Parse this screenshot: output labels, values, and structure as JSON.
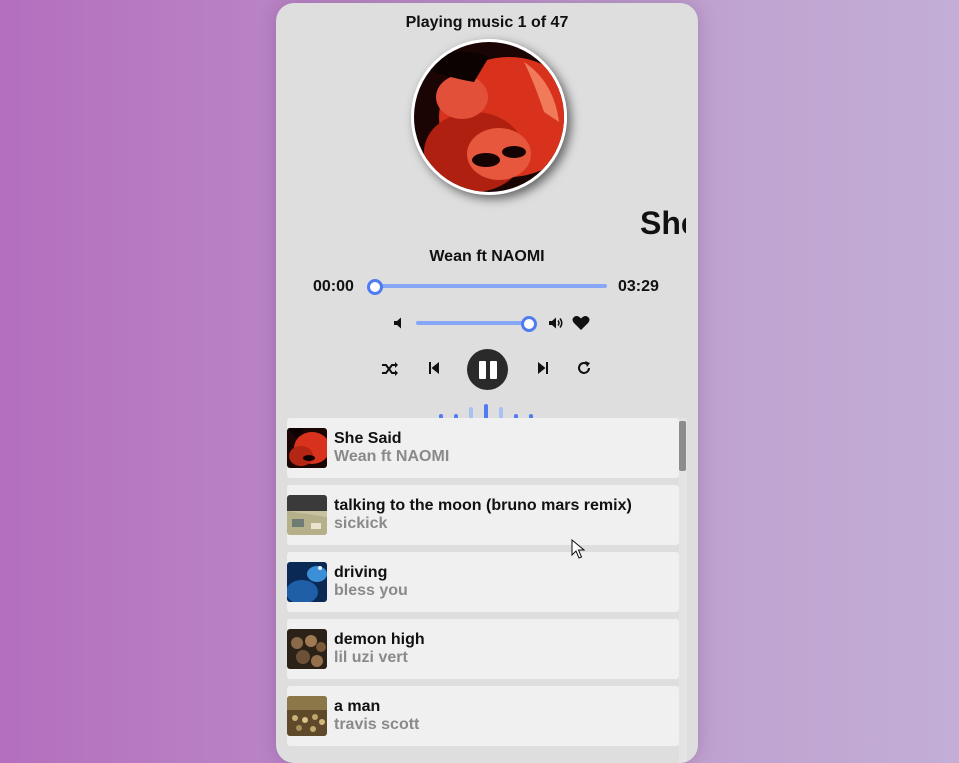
{
  "status_text": "Playing music 1 of 47",
  "now_playing": {
    "title": "She Said",
    "title_visible": "She",
    "artist": "Wean ft NAOMI",
    "current_time": "00:00",
    "total_time": "03:29",
    "progress_fraction": 0.0
  },
  "volume": {
    "level_fraction": 1.0
  },
  "colors": {
    "accent": "#4f7cf0",
    "track": "#86a7f6",
    "viz_light": "#a9c0f3"
  },
  "icons": {
    "volume_low": "volume-low-icon",
    "volume_high": "volume-high-icon",
    "favorite": "heart-icon",
    "shuffle": "shuffle-icon",
    "previous": "skip-back-icon",
    "play_pause": "pause-icon",
    "next": "skip-forward-icon",
    "repeat": "repeat-icon"
  },
  "playlist": [
    {
      "title": "She Said",
      "artist": "Wean ft NAOMI"
    },
    {
      "title": "talking to the moon (bruno mars remix)",
      "artist": "sickick"
    },
    {
      "title": "driving",
      "artist": "bless you"
    },
    {
      "title": "demon high",
      "artist": "lil uzi vert"
    },
    {
      "title": "a man",
      "artist": "travis scott"
    }
  ]
}
